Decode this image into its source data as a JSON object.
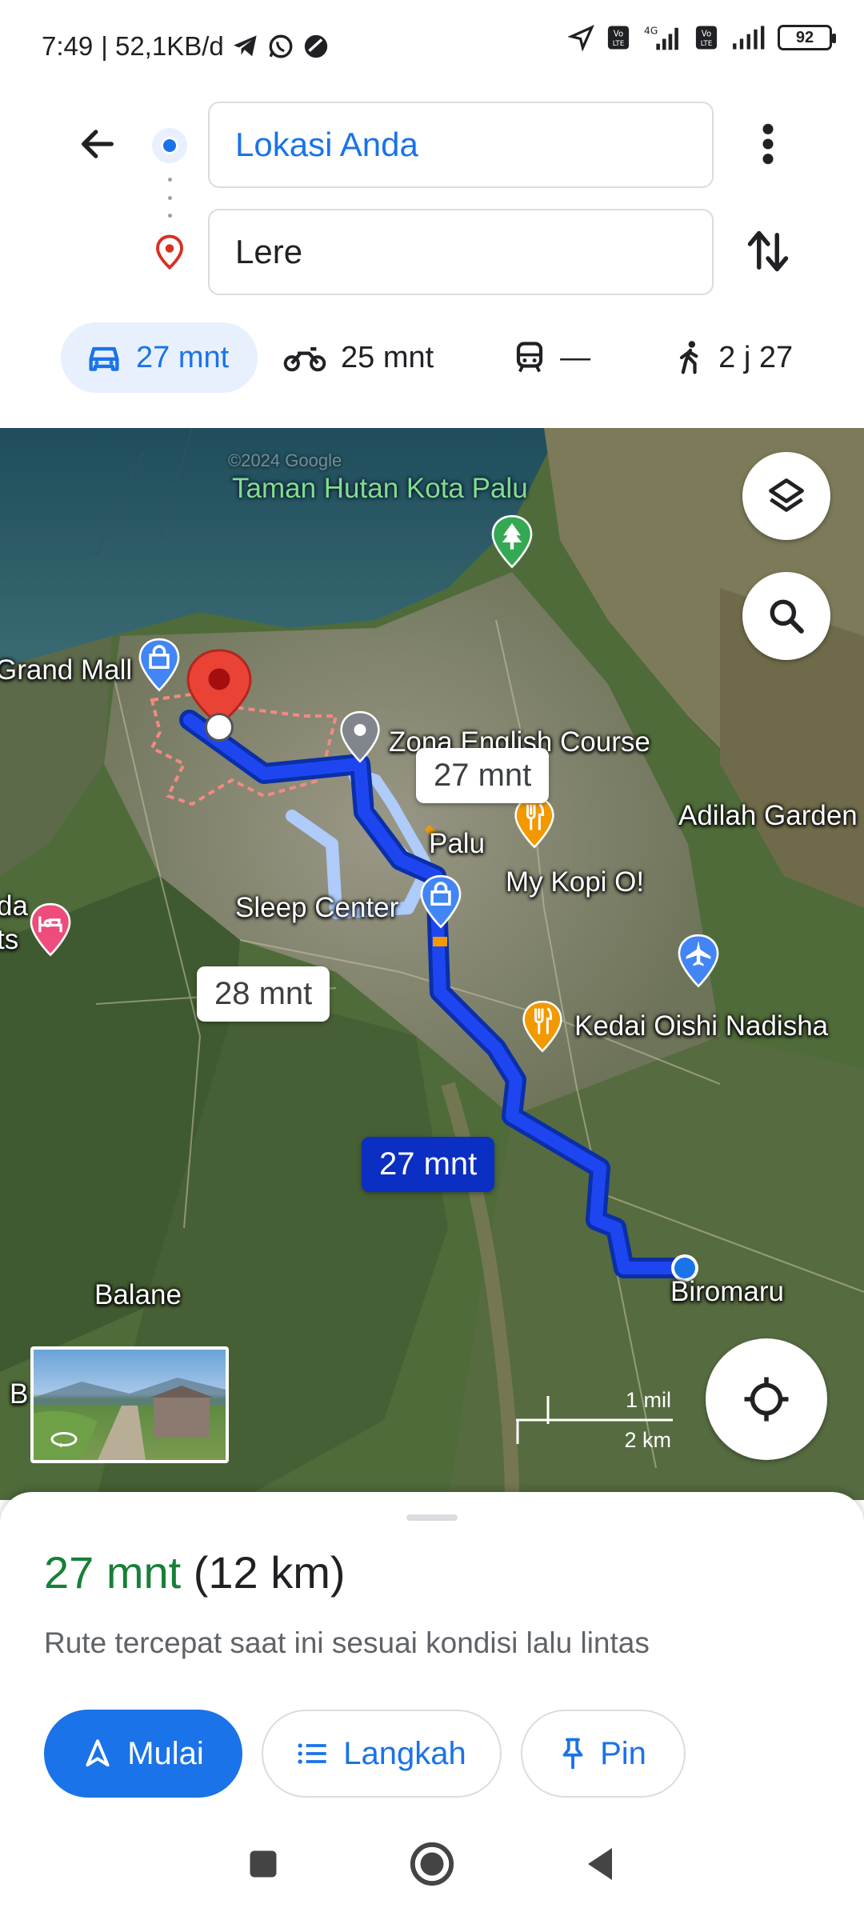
{
  "status_bar": {
    "time": "7:49",
    "speed": "| 52,1KB/d",
    "battery": "92",
    "icons": [
      "telegram-icon",
      "whatsapp-icon",
      "app-icon",
      "location-arrow-icon",
      "volte-icon",
      "signal-4g-icon",
      "volte-icon",
      "signal-icon",
      "battery-icon"
    ],
    "net1": "4G"
  },
  "search": {
    "origin": "Lokasi Anda",
    "destination": "Lere"
  },
  "modes": [
    {
      "name": "car",
      "label": "27 mnt",
      "active": true
    },
    {
      "name": "motorcycle",
      "label": "25 mnt",
      "active": false
    },
    {
      "name": "transit",
      "label": "—",
      "active": false
    },
    {
      "name": "walk",
      "label": "2 j 27",
      "active": false
    }
  ],
  "map": {
    "labels": {
      "taman": "Taman Hutan Kota Palu",
      "grand_mall": "Grand Mall",
      "zona": "Zona English Course",
      "adilah": "Adilah Garden",
      "palu": "Palu",
      "mykopi": "My Kopi O!",
      "sleep": "Sleep Center",
      "da": "da",
      "ts": "ts",
      "kedai": "Kedai Oishi Nadisha",
      "balane": "Balane",
      "biromaru": "Biromaru",
      "b": "B",
      "watermark": "©2024 Google"
    },
    "route_bubbles": {
      "alt1": "27 mnt",
      "alt2": "28 mnt",
      "main": "27 mnt"
    },
    "scale": {
      "mi": "1 mil",
      "km": "2 km"
    }
  },
  "sheet": {
    "time": "27 mnt",
    "distance": "(12 km)",
    "note": "Rute tercepat saat ini sesuai kondisi lalu lintas",
    "start": "Mulai",
    "steps": "Langkah",
    "pin": "Pin"
  },
  "colors": {
    "accent": "#1a73e8",
    "route": "#1a3fe0",
    "green": "#188038"
  }
}
